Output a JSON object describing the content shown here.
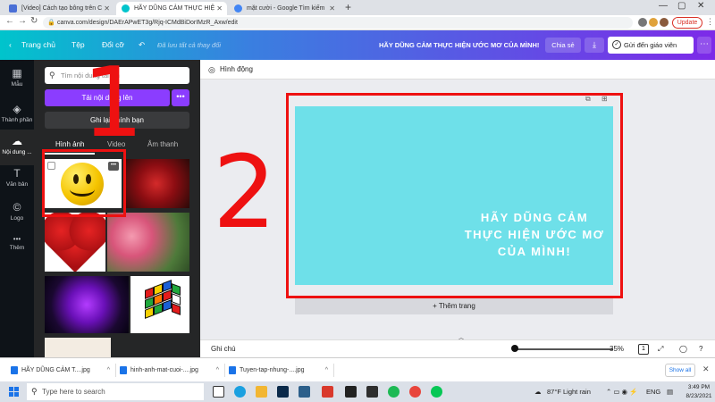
{
  "browser": {
    "tabs": [
      {
        "label": "[Video] Cách tạo bông trên Canva",
        "favicon_color": "#4a6fd6"
      },
      {
        "label": "HÃY DŨNG CẢM THỰC HIỆN ƯỚC",
        "favicon_color": "#00c4cc"
      },
      {
        "label": "mặt cười - Google Tìm kiếm",
        "favicon_color": "#4285f4"
      }
    ],
    "new_tab_label": "+",
    "url": "canva.com/design/DAErAPwET3g/Rjq-ICMdBiDorIMzR_Axw/edit",
    "update_label": "Update",
    "window_controls": [
      "—",
      "▢",
      "✕"
    ]
  },
  "canva_header": {
    "home_label": "Trang chủ",
    "file_label": "Tệp",
    "resize_label": "Đổi cỡ",
    "saved_status": "Đã lưu tất cả thay đổi",
    "design_title": "HÃY DŨNG CẢM THỰC HIỆN ƯỚC MƠ CỦA MÌNH!",
    "share_label": "Chia sẻ",
    "send_label": "Gửi đến giáo viên",
    "gradient_colors": [
      "#00c4cc",
      "#3a7fe0",
      "#7d2ae8"
    ]
  },
  "rail": {
    "items": [
      {
        "label": "Mẫu",
        "icon": "templates-icon",
        "glyph": "▦"
      },
      {
        "label": "Thành phần",
        "icon": "elements-icon",
        "glyph": "◈"
      },
      {
        "label": "Nội dung ...",
        "icon": "uploads-icon",
        "glyph": "☁"
      },
      {
        "label": "Văn bản",
        "icon": "text-icon",
        "glyph": "T"
      },
      {
        "label": "Logo",
        "icon": "logo-icon",
        "glyph": "©"
      },
      {
        "label": "Thêm",
        "icon": "more-icon",
        "glyph": "•••"
      }
    ]
  },
  "panel": {
    "search_placeholder": "Tìm nội dung tải lên",
    "upload_label": "Tải nội dung lên",
    "record_label": "Ghi lại chính bạn",
    "tabs": [
      "Hình ảnh",
      "Video",
      "Âm thanh"
    ],
    "thumbnails": [
      "smiley",
      "red-rose",
      "rose-heart",
      "pink-roses",
      "purple-rose",
      "rubik-cube",
      "tree"
    ]
  },
  "editor": {
    "toolbar_label": "Hình động",
    "page_text": "HÃY DŨNG CẢM THỰC HIỆN ƯỚC MƠ CỦA MÌNH!",
    "page_color": "#6ee0e9",
    "add_page_label": "+ Thêm trang",
    "notes_label": "Ghi chú",
    "zoom": "35%",
    "page_count": "1"
  },
  "annotations": {
    "label_1": "1",
    "label_2": "2",
    "color": "#ee1111"
  },
  "downloads": {
    "items": [
      "HÃY DŨNG CẢM T....jpg",
      "hinh-anh-mat-cuoi-....jpg",
      "Tuyen-tap-nhung-....jpg"
    ],
    "show_all_label": "Show all"
  },
  "taskbar": {
    "search_placeholder": "Type here to search",
    "weather": "87°F  Light rain",
    "language": "ENG",
    "time": "3:49 PM",
    "date": "8/23/2021"
  }
}
